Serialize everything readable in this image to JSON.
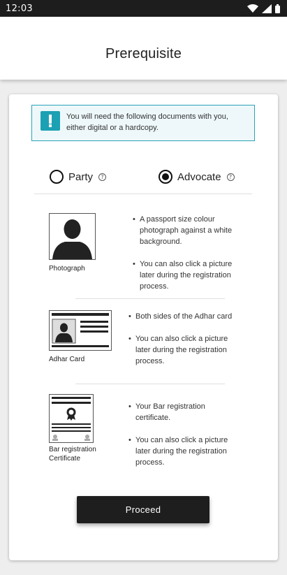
{
  "status_bar": {
    "time": "12:03",
    "icons": [
      "wifi-icon",
      "signal-icon",
      "battery-icon"
    ]
  },
  "app_bar": {
    "title": "Prerequisite"
  },
  "notice": {
    "icon": "exclamation-icon",
    "text": "You will need the following documents with you, either digital or a hardcopy."
  },
  "role_selector": {
    "options": [
      {
        "label": "Party",
        "selected": false
      },
      {
        "label": "Advocate",
        "selected": true
      }
    ],
    "help_glyph": "?"
  },
  "documents": [
    {
      "label": "Photograph",
      "icon": "person-silhouette-icon",
      "bullets": [
        "A passport size colour photograph against a white background.",
        "You can also click a picture later during the registration process."
      ]
    },
    {
      "label": "Adhar Card",
      "icon": "id-card-icon",
      "bullets": [
        "Both sides of the Adhar card",
        "You can also click a picture later during the registration process."
      ]
    },
    {
      "label": "Bar registration Certificate",
      "icon": "certificate-icon",
      "bullets": [
        "Your Bar registration certificate.",
        "You can also click a picture later during the registration process."
      ]
    }
  ],
  "actions": {
    "proceed_label": "Proceed"
  },
  "colors": {
    "accent": "#1ba1b3",
    "notice_bg": "#eef8fa",
    "button_bg": "#1e1e1e",
    "status_bar_bg": "#1d1d1d"
  }
}
